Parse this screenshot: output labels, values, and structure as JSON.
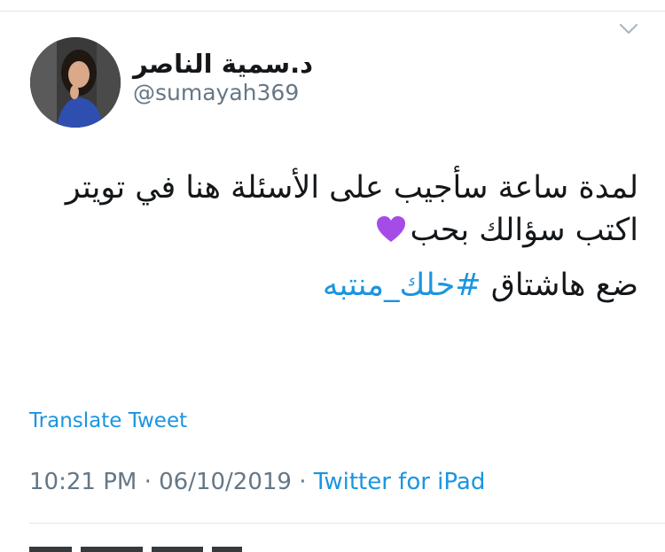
{
  "tweet": {
    "author": {
      "display_name": "د.سمية الناصر",
      "handle": "@sumayah369",
      "avatar": "profile-photo"
    },
    "text_lines": [
      "لمدة ساعة سأجيب على الأسئلة هنا في تويتر",
      "اكتب سؤالك بحب"
    ],
    "emoji": "purple-heart",
    "hashtag_prefix": "ضع هاشتاق ",
    "hashtag": "#خلك_منتبه",
    "translate_label": "Translate Tweet",
    "time": "10:21 PM",
    "date": "06/10/2019",
    "separator": "·",
    "source": "Twitter for iPad"
  },
  "colors": {
    "link": "#1b95e0",
    "text": "#14171a",
    "muted": "#657786",
    "divider": "#e1e8ed",
    "heart": "#a64ce6"
  },
  "icons": [
    "chevron-down-icon",
    "purple-heart-icon"
  ]
}
